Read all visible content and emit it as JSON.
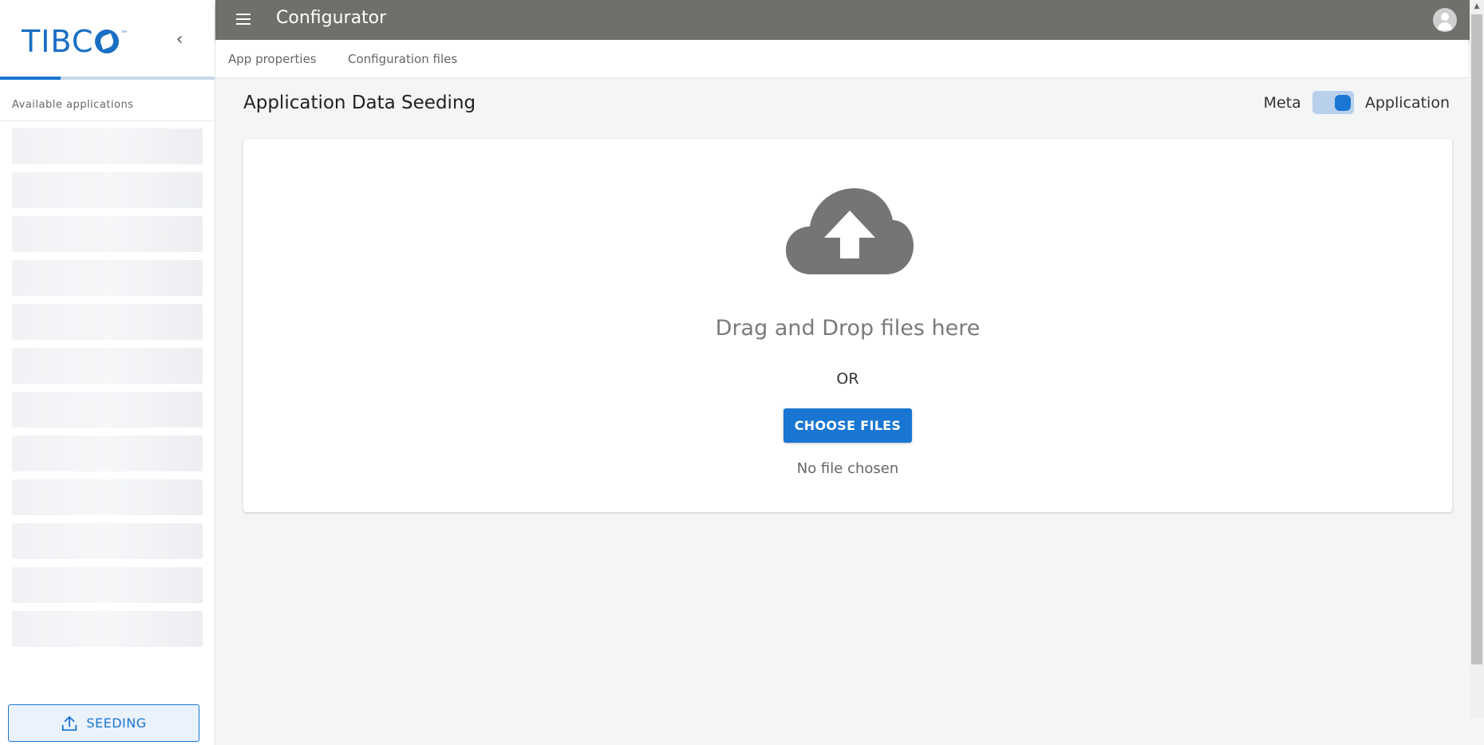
{
  "sidebar": {
    "logo_text": "TIBC",
    "logo_tm": "™",
    "collapse_icon": "‹",
    "available_label": "Available applications",
    "skeleton_count": 12,
    "seeding_label": "SEEDING"
  },
  "topbar": {
    "title": "Configurator"
  },
  "tabs": [
    {
      "label": "App properties"
    },
    {
      "label": "Configuration files"
    }
  ],
  "main": {
    "title": "Application Data Seeding",
    "toggle": {
      "left_label": "Meta",
      "right_label": "Application",
      "checked": true
    },
    "upload": {
      "drag_text": "Drag and Drop files here",
      "or_text": "OR",
      "choose_label": "CHOOSE FILES",
      "no_file_text": "No file chosen"
    }
  },
  "colors": {
    "accent": "#1976d2",
    "topbar": "#6f6f6b",
    "background": "#f4f5f5"
  }
}
